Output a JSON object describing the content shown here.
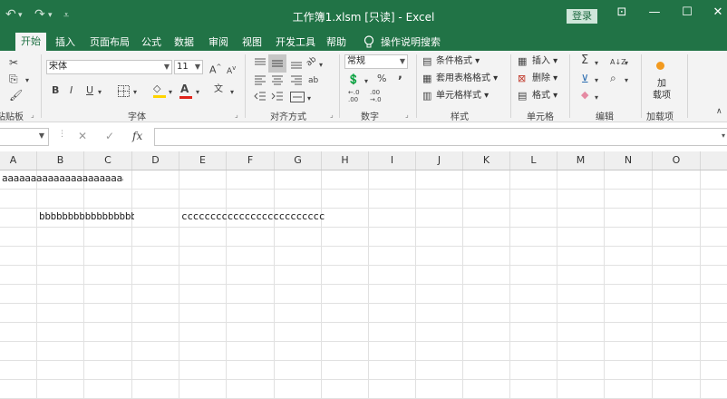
{
  "window": {
    "title": "工作簿1.xlsm  [只读]  -  Excel",
    "login_label": "登录",
    "controls": {
      "ribbon_display": "⊡",
      "minimize": "—",
      "restore": "☐",
      "close": "✕"
    }
  },
  "quick_access": {
    "undo": "↶",
    "undo_menu": "▾",
    "redo": "↷",
    "redo_menu": "▾",
    "customize": "⩡"
  },
  "tabs": [
    "开始",
    "插入",
    "页面布局",
    "公式",
    "数据",
    "审阅",
    "视图",
    "开发工具",
    "帮助"
  ],
  "tell_me": {
    "icon": "lightbulb-icon",
    "label": "操作说明搜索"
  },
  "ribbon": {
    "clipboard": {
      "label": "粘贴板",
      "launcher": "⌟"
    },
    "font": {
      "label": "字体",
      "name": "宋体",
      "size": "11",
      "grow": "A",
      "shrink": "A",
      "bold": "B",
      "italic": "I",
      "underline": "U",
      "fill_glyph": "A",
      "font_color_glyph": "A",
      "phonetic": "文",
      "launcher": "⌟",
      "fill_color": "#ffd400",
      "font_color": "#e0241b"
    },
    "alignment": {
      "label": "对齐方式",
      "wrap": "ab",
      "launcher": "⌟"
    },
    "number": {
      "label": "数字",
      "format": "常规",
      "percent": "%",
      "comma": ",",
      "inc_decimals": "←.0\n.00",
      "dec_decimals": ".00\n→.0",
      "launcher": "⌟"
    },
    "styles": {
      "label": "样式",
      "conditional": "条件格式",
      "table": "套用表格格式",
      "cell": "单元格样式"
    },
    "cells": {
      "label": "单元格",
      "insert": "插入",
      "delete": "删除",
      "format": "格式"
    },
    "editing": {
      "label": "编辑",
      "sum": "Σ",
      "sort": "A↓Z"
    },
    "addins": {
      "label": "加载项",
      "button": "加\n载项"
    }
  },
  "formula_bar": {
    "cancel": "✕",
    "enter": "✓",
    "function": "fx",
    "value": ""
  },
  "grid": {
    "columns": [
      "A",
      "B",
      "C",
      "D",
      "E",
      "F",
      "G",
      "H",
      "I",
      "J",
      "K",
      "L",
      "M",
      "N",
      "O"
    ],
    "cells": [
      {
        "ref": "A1",
        "text": "aaaaaaaaaaaaaaaaaaaaaaaaaaaaa"
      },
      {
        "ref": "B3",
        "text": "bbbbbbbbbbbbbbbbbbbbbb"
      },
      {
        "ref": "E3",
        "text": "ccccccccccccccccccccccccccc"
      }
    ]
  },
  "colors": {
    "accent": "#217346",
    "header_bg": "#efefef"
  }
}
